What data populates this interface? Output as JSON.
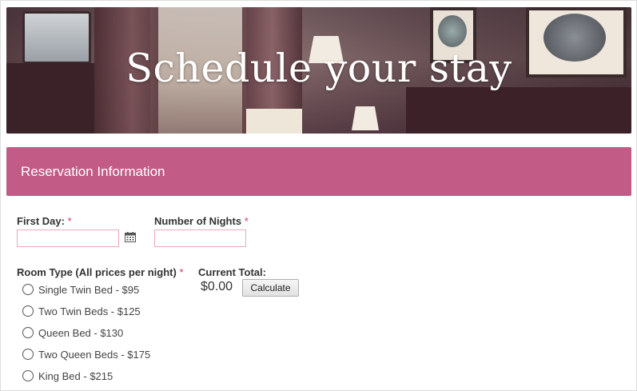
{
  "hero": {
    "title": "Schedule your stay"
  },
  "section": {
    "title": "Reservation Information"
  },
  "form": {
    "first_day_label": "First Day:",
    "first_day_value": "",
    "nights_label": "Number of Nights",
    "nights_value": "",
    "required_mark": "*",
    "room_type_label": "Room Type (All prices per night)",
    "room_options": [
      "Single Twin Bed - $95",
      "Two Twin Beds - $125",
      "Queen Bed - $130",
      "Two Queen Beds - $175",
      "King Bed - $215"
    ],
    "current_total_label": "Current Total:",
    "current_total_value": "$0.00",
    "calculate_label": "Calculate"
  },
  "colors": {
    "accent": "#c35b87",
    "required": "#d0365a",
    "input_border": "#e8a9bd"
  },
  "icons": {
    "date_picker": "calendar-icon"
  }
}
